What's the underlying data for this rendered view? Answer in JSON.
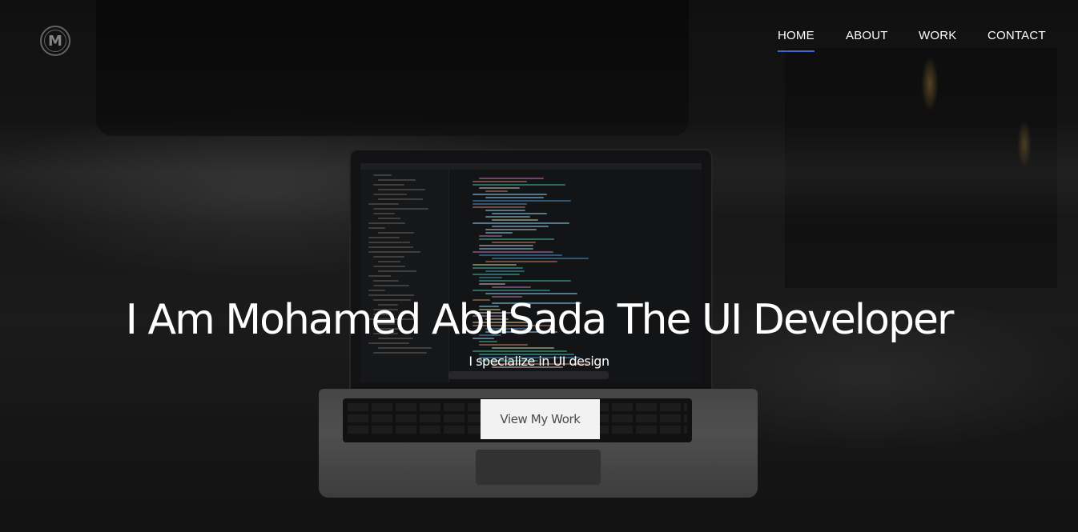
{
  "nav": {
    "logo_letter": "M",
    "items": [
      {
        "label": "HOME",
        "active": true
      },
      {
        "label": "ABOUT",
        "active": false
      },
      {
        "label": "WORK",
        "active": false
      },
      {
        "label": "CONTACT",
        "active": false
      }
    ],
    "active_underline_color": "#3f67d1"
  },
  "hero": {
    "title": "I Am Mohamed AbuSada The UI Developer",
    "subtitle": "I specialize in UI design",
    "cta_label": "View My Work"
  }
}
